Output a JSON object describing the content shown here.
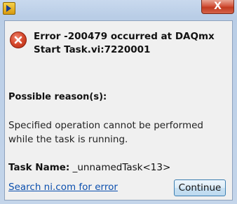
{
  "window": {
    "close_label": "X"
  },
  "dialog": {
    "error_title": "Error -200479 occurred at DAQmx Start Task.vi:7220001",
    "reason_label": "Possible reason(s):",
    "message": "Specified operation cannot be performed while the task is running.",
    "task_label": "Task Name:",
    "task_value": "_unnamedTask<13>",
    "search_link": "Search ni.com for error",
    "continue_label": "Continue"
  },
  "icons": {
    "app": "labview-app-icon",
    "error": "error-icon"
  },
  "colors": {
    "link": "#0b4fae",
    "error_red": "#d5482c",
    "close_red": "#c23a20"
  }
}
